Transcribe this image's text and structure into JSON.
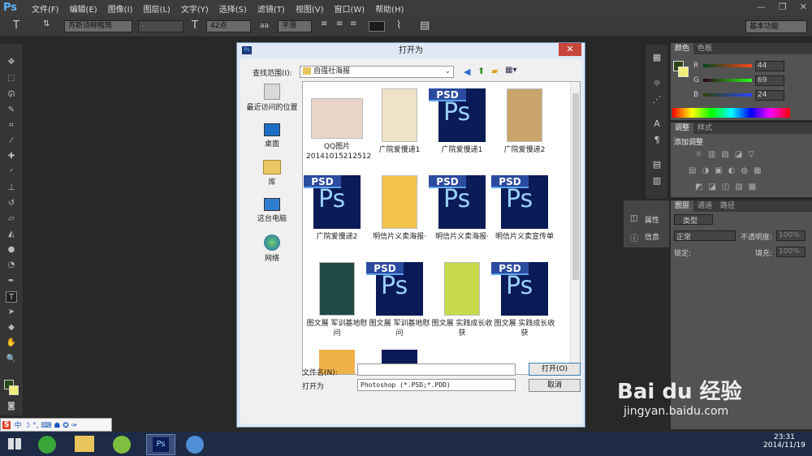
{
  "app": {
    "logo": "Ps",
    "menu": [
      "文件(F)",
      "编辑(E)",
      "图像(I)",
      "图层(L)",
      "文字(Y)",
      "选择(S)",
      "滤镜(T)",
      "视图(V)",
      "窗口(W)",
      "帮助(H)"
    ],
    "window_controls": [
      "—",
      "❐",
      "✕"
    ]
  },
  "options": {
    "font_family": "苏新诗柳楷简",
    "font_style": "-",
    "font_size": "42点",
    "antialias_icon": "aa",
    "antialias": "平滑",
    "workspace": "基本功能"
  },
  "panels": {
    "color": {
      "tabs": [
        "颜色",
        "色板"
      ],
      "r_label": "R",
      "r": "44",
      "g_label": "G",
      "g": "69",
      "b_label": "B",
      "b": "24"
    },
    "adjust": {
      "tabs": [
        "调整",
        "样式"
      ],
      "title": "添加调整"
    },
    "layers": {
      "tabs": [
        "图层",
        "通道",
        "路径"
      ],
      "kind": "类型",
      "blend": "正常",
      "opacity_label": "不透明度:",
      "lock_label": "锁定:",
      "fill_label": "填充:",
      "percent": "100%"
    },
    "flyout": {
      "props": "属性",
      "info": "信息"
    }
  },
  "dialog": {
    "title": "打开为",
    "close": "✕",
    "lookin_label": "查找范围(I):",
    "lookin_value": "自强社海报",
    "places": [
      "最近访问的位置",
      "桌面",
      "库",
      "这台电脑",
      "网络"
    ],
    "files": [
      {
        "name": "QQ图片20141015212512",
        "type": "img"
      },
      {
        "name": "广院爱慢递1",
        "type": "img"
      },
      {
        "name": "广院爱慢递1",
        "type": "psd"
      },
      {
        "name": "广院爱慢递2",
        "type": "img"
      },
      {
        "name": "广院爱慢递2",
        "type": "psd"
      },
      {
        "name": "明信片义卖海报·",
        "type": "img"
      },
      {
        "name": "明信片义卖海报·",
        "type": "psd"
      },
      {
        "name": "明信片义卖宣传单",
        "type": "psd"
      },
      {
        "name": "图文展 军训基地慰问",
        "type": "img"
      },
      {
        "name": "图文展 军训基地慰问",
        "type": "psd"
      },
      {
        "name": "图文展 实践成长收获",
        "type": "img"
      },
      {
        "name": "图文展 实践成长收获",
        "type": "psd"
      }
    ],
    "psd_label": "PSD",
    "ps_label": "Ps",
    "filename_label": "文件名(N):",
    "filename_value": "",
    "openas_label": "打开为",
    "openas_value": "Photoshop (*.PSD;*.PDD)",
    "open_button": "打开(O)",
    "cancel_button": "取消"
  },
  "taskbar": {
    "time": "23:31",
    "date": "2014/11/19"
  },
  "watermark": {
    "brand": "Bai du 经验",
    "url": "jingyan.baidu.com"
  }
}
